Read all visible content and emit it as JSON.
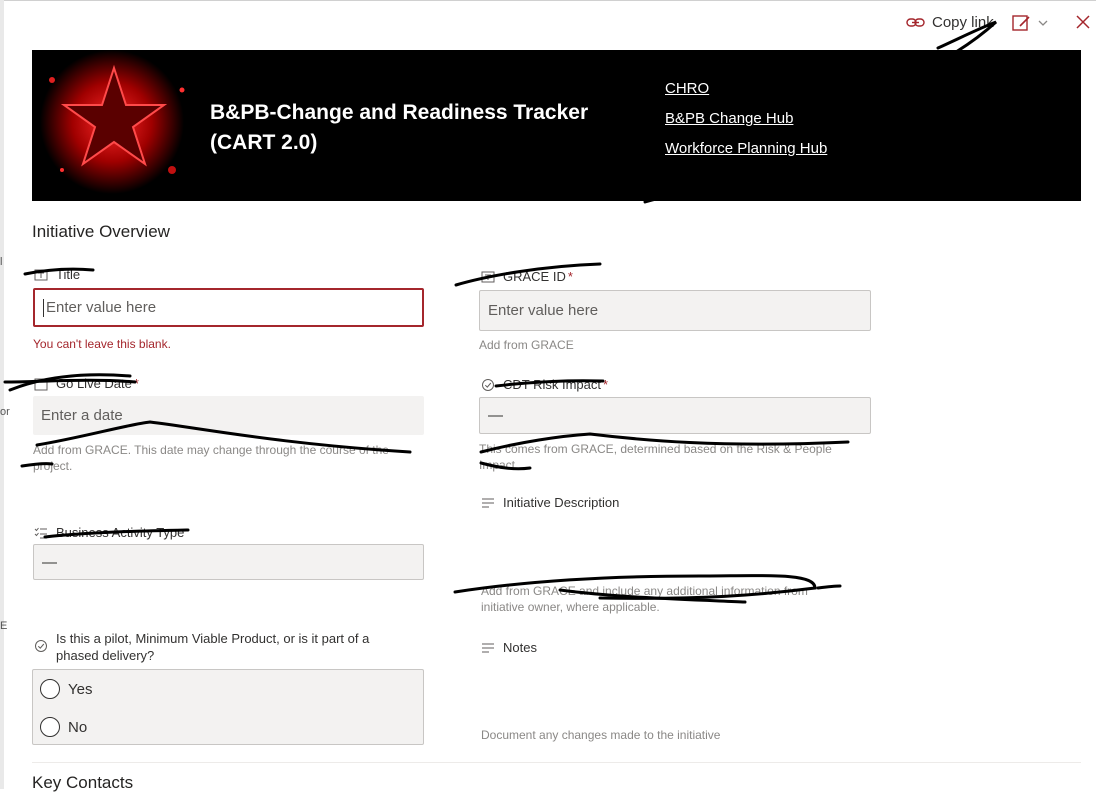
{
  "header": {
    "copy_link_label": "Copy link"
  },
  "banner": {
    "title_line1": "B&PB-Change and Readiness Tracker",
    "title_line2": "(CART 2.0)",
    "links": [
      "CHRO",
      "B&PB Change Hub",
      "Workforce Planning Hub"
    ]
  },
  "sections": {
    "initiative_overview": "Initiative Overview",
    "key_contacts": "Key Contacts"
  },
  "fields": {
    "title": {
      "label": "Title",
      "placeholder": "Enter value here",
      "error": "You can't leave this blank."
    },
    "grace_id": {
      "label": "GRACE ID",
      "placeholder": "Enter value here",
      "help": "Add from GRACE"
    },
    "go_live_date": {
      "label": "Go Live Date",
      "placeholder": "Enter a date",
      "help_line1": "Add from GRACE. This date may change through the course of the",
      "help_line2": "project."
    },
    "cdt_risk_impact": {
      "label": "CDT Risk Impact",
      "value": "—",
      "help_line1": "This comes from GRACE, determined based on the Risk & People",
      "help_line2": "Impact."
    },
    "initiative_description": {
      "label": "Initiative Description",
      "help_line1": "Add from GRACE and include any additional information from",
      "help_line2": "initiative owner, where applicable."
    },
    "business_activity_type": {
      "label": "Business Activity Type",
      "value": "—"
    },
    "pilot_question": {
      "label_line1": "Is this a pilot, Minimum Viable Product, or is it part of a",
      "label_line2": "phased delivery?",
      "options": [
        "Yes",
        "No"
      ]
    },
    "notes": {
      "label": "Notes",
      "help": "Document any changes made to the initiative"
    }
  },
  "required_marker": "*"
}
